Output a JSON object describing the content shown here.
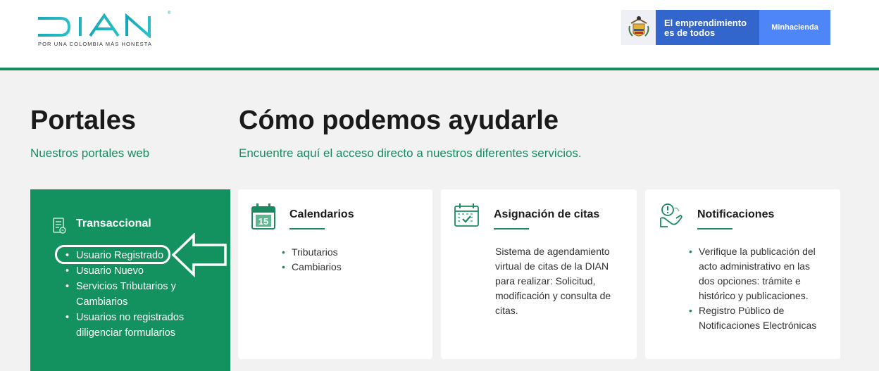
{
  "header": {
    "logo_text": "DIAN",
    "logo_tagline": "POR UNA COLOMBIA MÁS HONESTA",
    "gov": {
      "slogan_line1": "El emprendimiento",
      "slogan_line2": "es de todos",
      "ministry": "Minhacienda"
    }
  },
  "portales": {
    "title": "Portales",
    "subtitle": "Nuestros portales web"
  },
  "ayuda": {
    "title": "Cómo podemos ayudarle",
    "subtitle": "Encuentre aquí el acceso directo a nuestros diferentes servicios."
  },
  "transaccional": {
    "title": "Transaccional",
    "items": [
      "Usuario Registrado",
      "Usuario Nuevo",
      "Servicios Tributarios y Cambiarios",
      "Usuarios no registrados diligenciar formularios"
    ]
  },
  "cards": [
    {
      "title": "Calendarios",
      "icon": "calendar-15-icon",
      "icon_number": "15",
      "items": [
        "Tributarios",
        "Cambiarios"
      ]
    },
    {
      "title": "Asignación de citas",
      "icon": "calendar-check-icon",
      "body": "Sistema de agendamiento virtual de citas de la DIAN para realizar: Solicitud, modificación y consulta de citas."
    },
    {
      "title": "Notificaciones",
      "icon": "notification-hand-icon",
      "items": [
        "Verifique la publicación del acto administrativo en las dos opciones: trámite e histórico y publicaciones.",
        "Registro Público de Notificaciones Electrónicas"
      ]
    }
  ],
  "colors": {
    "brand_green": "#1b8a61",
    "panel_green": "#13925f",
    "gov_blue": "#3366cc",
    "gov_light_blue": "#4f86f7"
  }
}
